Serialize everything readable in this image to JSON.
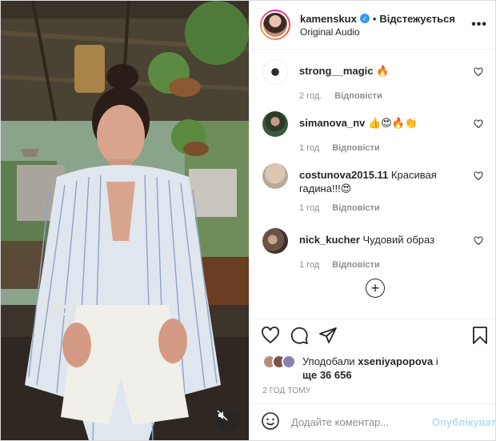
{
  "header": {
    "username": "kamenskux",
    "separator": "•",
    "follow_label": "Відстежується",
    "audio": "Original Audio",
    "more_label": "•••"
  },
  "comments": [
    {
      "user": "strong__magic",
      "text": "🔥",
      "time": "2 год.",
      "reply": "Відповісти",
      "avatar_color": "#ffffff"
    },
    {
      "user": "simanova_nv",
      "text": "👍😍🔥👏",
      "time": "1 год",
      "reply": "Відповісти",
      "avatar_color": "#3d5a3c"
    },
    {
      "user": "costunova2015.11",
      "text": "Красивая гадина!!!😍",
      "time": "1 год",
      "reply": "Відповісти",
      "avatar_color": "#d9c7b5"
    },
    {
      "user": "nick_kucher",
      "text": "Чудовий образ",
      "time": "1 год",
      "reply": "Відповісти",
      "avatar_color": "#6b5446"
    }
  ],
  "load_more": "+",
  "likes": {
    "prefix": "Уподобали ",
    "user": "xseniyapopova",
    "suffix": " і",
    "line2_prefix": "ще ",
    "count": "36 656"
  },
  "timestamp": "2 ГОД ТОМУ",
  "add_comment": {
    "placeholder": "Додайте коментар...",
    "publish_label": "Опублікувати"
  },
  "colors": {
    "link_blue": "#b2dffc",
    "muted": "#8e8e8e",
    "verified": "#3897f0"
  }
}
